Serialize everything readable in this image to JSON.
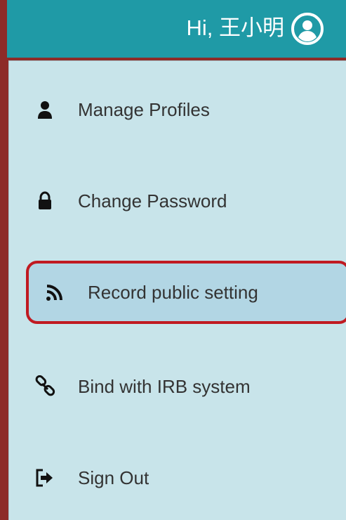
{
  "header": {
    "greeting": "Hi, 王小明",
    "avatar_icon": "user-circle-icon"
  },
  "menu": {
    "items": [
      {
        "label": "Manage Profiles",
        "icon": "user-icon"
      },
      {
        "label": "Change Password",
        "icon": "lock-icon"
      },
      {
        "label": "Record public setting",
        "icon": "rss-icon",
        "selected": true
      },
      {
        "label": "Bind with IRB system",
        "icon": "link-icon"
      },
      {
        "label": "Sign Out",
        "icon": "sign-out-icon"
      }
    ]
  },
  "colors": {
    "header_bg": "#1f9aa6",
    "menu_bg": "#c8e4ea",
    "selected_bg": "#b2d6e4",
    "highlight_border": "#c01a21",
    "page_bg": "#8d2b28"
  }
}
